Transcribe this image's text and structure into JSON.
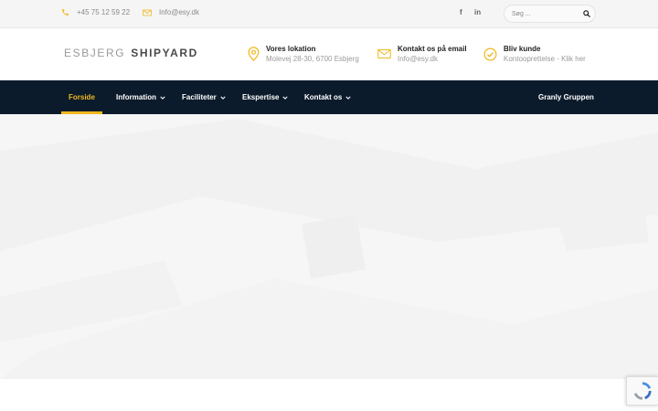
{
  "topbar": {
    "phone": "+45 75 12 59 22",
    "email": "Info@esy.dk",
    "social": {
      "facebook": "f",
      "linkedin": "in"
    },
    "search": {
      "placeholder": "Søg ..."
    }
  },
  "header": {
    "logo": {
      "part1": "ESBJERG",
      "part2": "SHIPYARD"
    },
    "info": [
      {
        "title": "Vores lokation",
        "subtitle": "Molevej 28-30, 6700 Esbjerg",
        "icon": "map-pin-icon"
      },
      {
        "title": "Kontakt os på email",
        "subtitle": "Info@esy.dk",
        "icon": "envelope-icon"
      },
      {
        "title": "Bliv kunde",
        "subtitle": "Kontooprettelse - Klik her",
        "icon": "check-circle-icon"
      }
    ]
  },
  "nav": {
    "items": [
      {
        "label": "Forside",
        "active": true
      },
      {
        "label": "Information"
      },
      {
        "label": "Faciliteter"
      },
      {
        "label": "Ekspertise"
      },
      {
        "label": "Kontakt os"
      }
    ],
    "right": "Granly Gruppen"
  },
  "colors": {
    "accent": "#f0b81e",
    "nav_bg": "#0c1b2c",
    "topbar_bg": "#f5f5f5"
  }
}
